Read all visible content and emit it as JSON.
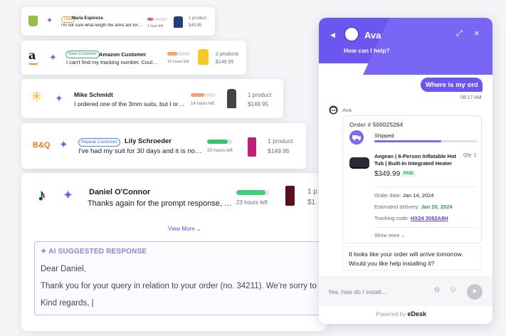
{
  "tickets": [
    {
      "id": "maria",
      "tag": "Lead",
      "name": "Maria Espinoza",
      "message": "I'm not sure what length the arms are for th...",
      "hours": "1 hour left",
      "products": "1 product",
      "price": "$49.95",
      "bar_fill": 0.3,
      "bar_color": "#f15c5c"
    },
    {
      "id": "amazon",
      "tag": "New Customer",
      "name": "Amazon Customer",
      "message": "I can't find my tracking number. Could you...",
      "hours": "10 hours left",
      "products": "2 products",
      "price": "$149.95",
      "bar_fill": 0.45,
      "bar_color": "#f5a560"
    },
    {
      "id": "mike",
      "tag": "",
      "name": "Mike Schmidt",
      "message": "I ordered one of the 3mm suits, but I order...",
      "hours": "14 hours left",
      "products": "1 product",
      "price": "$149.95",
      "bar_fill": 0.55,
      "bar_color": "#f5a070"
    },
    {
      "id": "lily",
      "tag": "Repeat Customer",
      "name": "Lily Schroeder",
      "message": "I've had my suit for 30 days and it is not qui...",
      "hours": "20 hours left",
      "products": "1 product",
      "price": "$149.95",
      "bar_fill": 0.8,
      "bar_color": "#3fbf70"
    },
    {
      "id": "daniel",
      "tag": "",
      "name": "Daniel O'Connor",
      "message": "Thanks again for the prompt response, I've...",
      "hours": "23 hours left",
      "products": "1 p",
      "price": "$1",
      "bar_fill": 0.9,
      "bar_color": "#3fcf78"
    }
  ],
  "panel": {
    "view_more": "View More",
    "ai_heading": "AI SUGGESTED RESPONSE",
    "greeting": "Dear Daniel,",
    "body": "Thank you for your query in relation to your order (no. 34211). We're sorry to hea",
    "closing": "Kind regards, |"
  },
  "chat": {
    "bot_name": "Ava",
    "subtitle": "How can I help?",
    "user_message": "Where is my order?",
    "time": "08:17 AM",
    "bot_label": "Ava",
    "order": {
      "number": "Order # 500025264",
      "status": "Shipped",
      "progress": 0.65,
      "product_name": "Aegean | 6-Person Inflatable Hot Tub | Built-In Integrated Heater",
      "qty": "Qty: 1",
      "price": "$349.99",
      "paid": "PAID",
      "order_date_label": "Order date:",
      "order_date": "Jan 14, 2024",
      "delivery_label": "Estimated delivery:",
      "delivery": "Jan 20, 2024",
      "tracking_label": "Tracking code:",
      "tracking": "HX24 3082A8H",
      "show_more": "Show more"
    },
    "bot_reply": "It looks like your order will arrive tomorrow. Would you like help installing it?",
    "input_placeholder": "Yes, how do I install...",
    "powered_by": "Powered by",
    "powered_brand": "eDesk"
  },
  "colors": {
    "accent": "#6c56f0",
    "sparkle": "#7a5cf0"
  }
}
